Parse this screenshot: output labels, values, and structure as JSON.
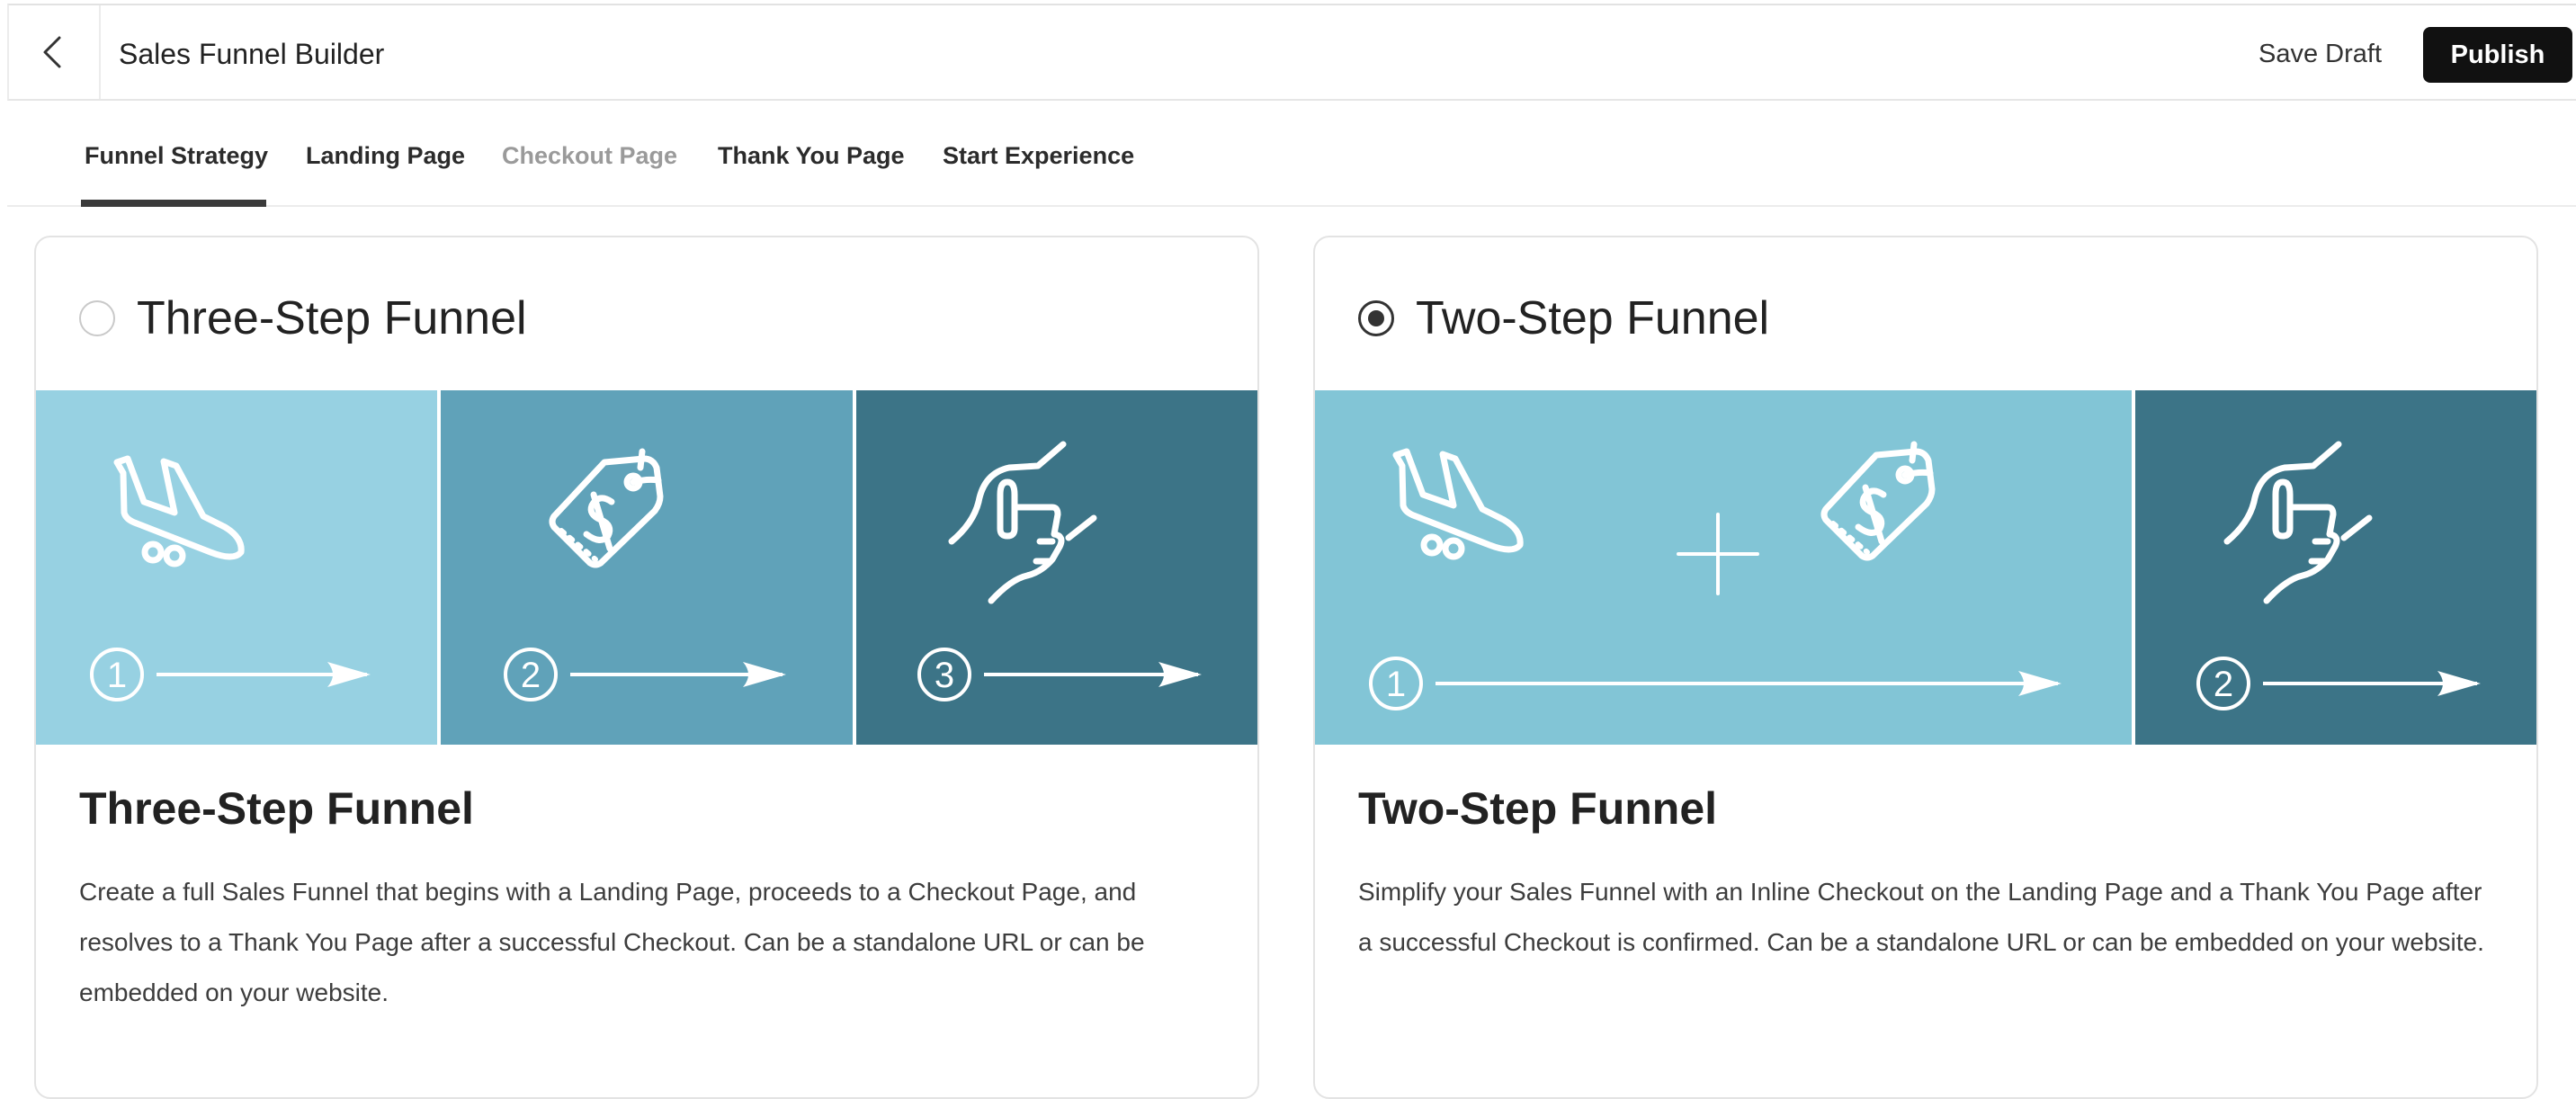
{
  "header": {
    "title": "Sales Funnel Builder",
    "save_draft_label": "Save Draft",
    "publish_label": "Publish",
    "back_icon": "chevron-left-icon"
  },
  "tabs": [
    {
      "label": "Funnel Strategy",
      "active": true,
      "enabled": true
    },
    {
      "label": "Landing Page",
      "active": false,
      "enabled": true
    },
    {
      "label": "Checkout Page",
      "active": false,
      "enabled": false
    },
    {
      "label": "Thank You Page",
      "active": false,
      "enabled": true
    },
    {
      "label": "Start Experience",
      "active": false,
      "enabled": true
    }
  ],
  "options": [
    {
      "header_label": "Three-Step Funnel",
      "selected": false,
      "title": "Three-Step Funnel",
      "description": "Create a full Sales Funnel that begins with a Landing Page, proceeds to a Checkout Page, and resolves to a Thank You Page after a successful Checkout. Can be a standalone URL or can be embedded on your website.",
      "steps": [
        "1",
        "2",
        "3"
      ],
      "icons": [
        "airplane-landing-icon",
        "price-tag-icon",
        "handshake-icon"
      ]
    },
    {
      "header_label": "Two-Step Funnel",
      "selected": true,
      "title": "Two-Step Funnel",
      "description": "Simplify your Sales Funnel with an Inline Checkout on the Landing Page and a Thank You Page after a successful Checkout is confirmed. Can be a standalone URL or can be embedded on your website.",
      "steps": [
        "1",
        "2"
      ],
      "icons": [
        "airplane-landing-icon",
        "plus-icon",
        "price-tag-icon",
        "handshake-icon"
      ]
    }
  ],
  "colors": {
    "panel_light": "#97d1e2",
    "panel_mid": "#60a2b9",
    "panel_dark": "#3c7487",
    "panel_two_light": "#82c5d6",
    "primary_button": "#111111",
    "active_tab_underline": "#3a3a3a"
  }
}
